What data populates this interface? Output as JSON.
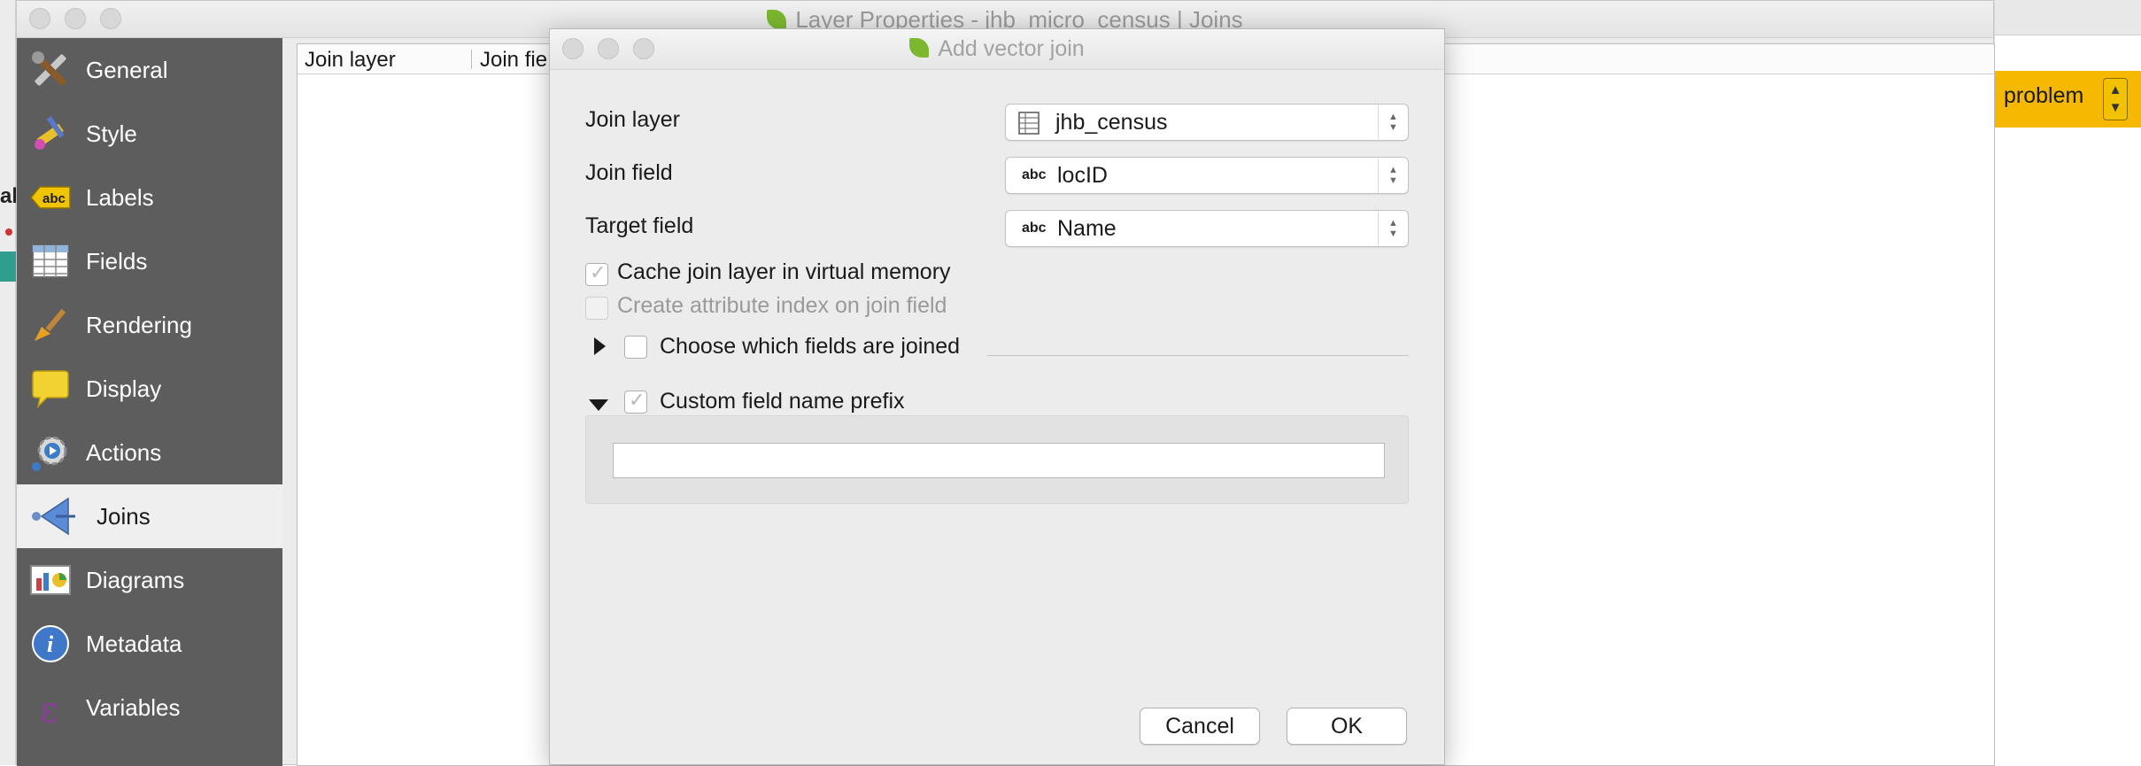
{
  "background": {
    "left_app_label": "ab",
    "right_app": {
      "problem_label": "problem",
      "arrows": [
        "▲",
        "▼"
      ]
    }
  },
  "main_window": {
    "title": "Layer Properties - jhb_micro_census | Joins",
    "sidebar": {
      "items": [
        {
          "label": "General",
          "icon": "tools-icon"
        },
        {
          "label": "Style",
          "icon": "paintbrush-icon"
        },
        {
          "label": "Labels",
          "icon": "labels-abc-icon"
        },
        {
          "label": "Fields",
          "icon": "fields-table-icon"
        },
        {
          "label": "Rendering",
          "icon": "rendering-brush-icon"
        },
        {
          "label": "Display",
          "icon": "speech-bubble-icon"
        },
        {
          "label": "Actions",
          "icon": "actions-gear-icon"
        },
        {
          "label": "Joins",
          "icon": "joins-arrow-icon"
        },
        {
          "label": "Diagrams",
          "icon": "diagrams-chart-icon"
        },
        {
          "label": "Metadata",
          "icon": "info-icon"
        },
        {
          "label": "Variables",
          "icon": "epsilon-icon"
        }
      ],
      "active": "Joins"
    },
    "joins_table": {
      "columns": [
        "Join layer",
        "Join fie"
      ]
    }
  },
  "dialog": {
    "title": "Add vector join",
    "join_layer": {
      "label": "Join layer",
      "value": "jhb_census"
    },
    "join_field": {
      "label": "Join field",
      "type_tag": "abc",
      "value": "locID"
    },
    "target_field": {
      "label": "Target field",
      "type_tag": "abc",
      "value": "Name"
    },
    "cache_checkbox": {
      "label": "Cache join layer in virtual memory",
      "checked": true,
      "enabled": true
    },
    "index_checkbox": {
      "label": "Create attribute index on join field",
      "checked": false,
      "enabled": false
    },
    "choose_fields_group": {
      "label": "Choose which fields are joined",
      "expanded": false,
      "checked": false
    },
    "prefix_group": {
      "label": "Custom field name prefix",
      "expanded": true,
      "checked": true,
      "input_value": ""
    },
    "buttons": {
      "cancel": "Cancel",
      "ok": "OK"
    }
  },
  "colors": {
    "sidebar_bg": "#5d5d5d",
    "problem_bar": "#f6b800",
    "qgis_leaf": "#7cb82f"
  }
}
